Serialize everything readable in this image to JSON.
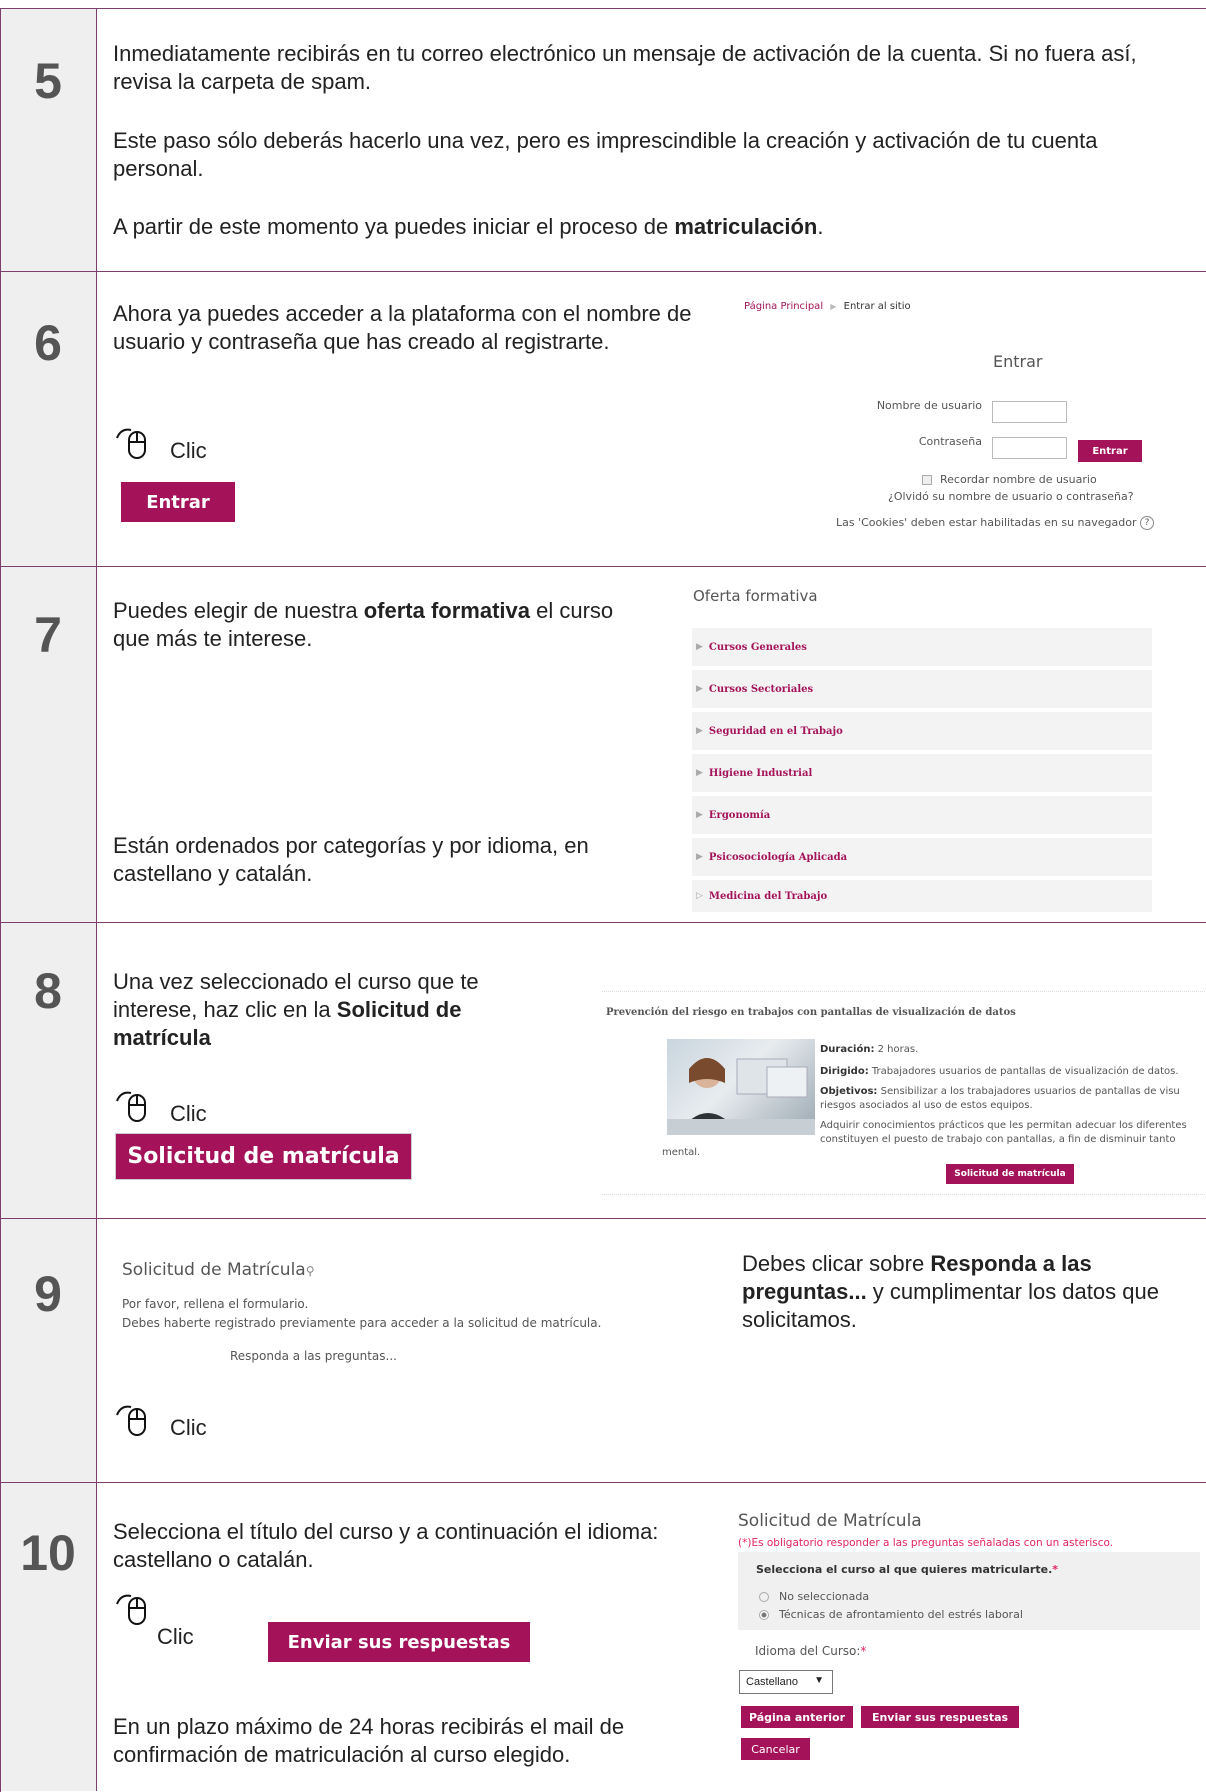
{
  "steps": {
    "s5": {
      "number": "5",
      "p1": "Inmediatamente recibirás en tu correo electrónico un mensaje de activación de la cuenta. Si no fuera así, revisa la carpeta de spam.",
      "p2": "Este paso sólo deberás hacerlo una vez, pero es imprescindible la creación y activación de tu cuenta personal.",
      "p3_pre": "A partir de este momento ya puedes iniciar el proceso de ",
      "p3_bold": "matriculación",
      "p3_post": "."
    },
    "s6": {
      "number": "6",
      "text": "Ahora ya puedes acceder a la plataforma con el nombre de usuario y contraseña que has creado al registrarte.",
      "clic": "Clic",
      "button": "Entrar",
      "shot": {
        "breadcrumb_home": "Página Principal",
        "breadcrumb_sep": "▶",
        "breadcrumb_current": "Entrar al sitio",
        "heading": "Entrar",
        "username_label": "Nombre de usuario",
        "password_label": "Contraseña",
        "login_button": "Entrar",
        "remember": "Recordar nombre de usuario",
        "forgot": "¿Olvidó su nombre de usuario o contraseña?",
        "cookies": "Las 'Cookies' deben estar habilitadas en su navegador"
      }
    },
    "s7": {
      "number": "7",
      "text_pre": "Puedes elegir de nuestra ",
      "text_bold": "oferta formativa",
      "text_post": " el curso que más te interese.",
      "text2": "Están ordenados por categorías y por idioma, en castellano y catalán.",
      "shot": {
        "heading": "Oferta formativa",
        "categories": [
          "Cursos Generales",
          "Cursos Sectoriales",
          "Seguridad en el Trabajo",
          "Higiene Industrial",
          "Ergonomía",
          "Psicosociología Aplicada",
          "Medicina del Trabajo"
        ]
      }
    },
    "s8": {
      "number": "8",
      "text_pre": "Una vez seleccionado el curso que te interese, haz clic en la ",
      "text_bold": "Solicitud de matrícula",
      "clic": "Clic",
      "button": "Solicitud de matrícula",
      "shot": {
        "title": "Prevención del riesgo en trabajos con pantallas de visualización de datos",
        "duracion_label": "Duración:",
        "duracion": "2 horas.",
        "dirigido_label": "Dirigido:",
        "dirigido": "Trabajadores usuarios de pantallas de visualización de datos.",
        "objetivos_label": "Objetivos:",
        "objetivos": "Sensibilizar a los trabajadores usuarios de pantallas de visu",
        "objetivos2": "riesgos asociados al uso de estos equipos.",
        "adquirir": "Adquirir conocimientos prácticos que les permitan adecuar los diferentes",
        "adquirir2": "constituyen el puesto de trabajo con pantallas, a fin de disminuir tanto",
        "mental": "mental.",
        "button": "Solicitud de matrícula"
      }
    },
    "s9": {
      "number": "9",
      "clic": "Clic",
      "text_pre": "Debes clicar sobre ",
      "text_bold": "Responda a las preguntas...",
      "text_post": " y cumplimentar los datos que solicitamos.",
      "shot": {
        "heading": "Solicitud de Matrícula",
        "line1": "Por favor, rellena el formulario.",
        "line2": "Debes haberte registrado previamente para acceder a la solicitud de matrícula.",
        "link": "Responda a las preguntas..."
      }
    },
    "s10": {
      "number": "10",
      "text": "Selecciona el título del curso y a continuación el idioma: castellano o catalán.",
      "clic": "Clic",
      "button": "Enviar sus respuestas",
      "text2": "En un plazo máximo de 24 horas recibirás el mail de confirmación de matriculación al curso elegido.",
      "shot": {
        "heading": "Solicitud de Matrícula",
        "required_note": "(*)Es obligatorio responder a las preguntas señaladas con un asterisco.",
        "question": "Selecciona el curso al que quieres matricularte.",
        "asterisk": "*",
        "option1": "No seleccionada",
        "option2": "Técnicas de afrontamiento del estrés laboral",
        "language_label": "Idioma del Curso:",
        "language_value": "Castellano",
        "prev_button": "Página anterior",
        "send_button": "Enviar sus respuestas",
        "cancel_button": "Cancelar"
      }
    }
  }
}
